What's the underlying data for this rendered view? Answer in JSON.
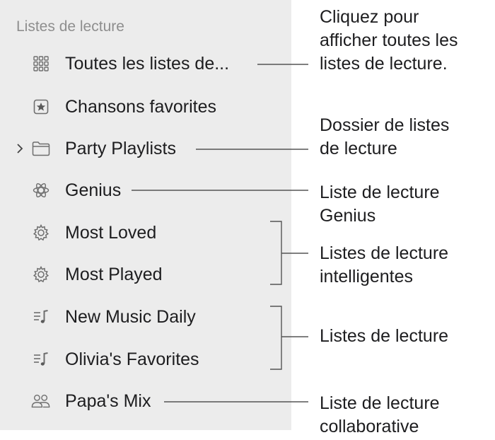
{
  "sidebar": {
    "section_title": "Listes de lecture",
    "items": [
      {
        "label": "Toutes les listes de...",
        "icon": "all-playlists-grid-icon"
      },
      {
        "label": "Chansons favorites",
        "icon": "star-square-icon"
      },
      {
        "label": "Party Playlists",
        "icon": "folder-icon",
        "disclosure": "chevron-right-icon"
      },
      {
        "label": "Genius",
        "icon": "genius-atom-icon"
      },
      {
        "label": "Most Loved",
        "icon": "smart-playlist-gear-icon"
      },
      {
        "label": "Most Played",
        "icon": "smart-playlist-gear-icon"
      },
      {
        "label": "New Music Daily",
        "icon": "playlist-music-note-icon"
      },
      {
        "label": "Olivia's Favorites",
        "icon": "playlist-music-note-icon"
      },
      {
        "label": "Papa's Mix",
        "icon": "collaborative-people-icon"
      }
    ]
  },
  "callouts": [
    {
      "lines": [
        "Cliquez pour",
        "afficher toutes les",
        "listes de lecture."
      ]
    },
    {
      "lines": [
        "Dossier de listes",
        "de lecture"
      ]
    },
    {
      "lines": [
        "Liste de lecture",
        "Genius"
      ]
    },
    {
      "lines": [
        "Listes de lecture",
        "intelligentes"
      ]
    },
    {
      "lines": [
        "Listes de lecture"
      ]
    },
    {
      "lines": [
        "Liste de lecture",
        "collaborative"
      ]
    }
  ],
  "colors": {
    "sidebar_bg": "#ececec",
    "section_header": "#8e8e8e",
    "icon": "#6e6e6e",
    "leader_line": "#555555"
  }
}
